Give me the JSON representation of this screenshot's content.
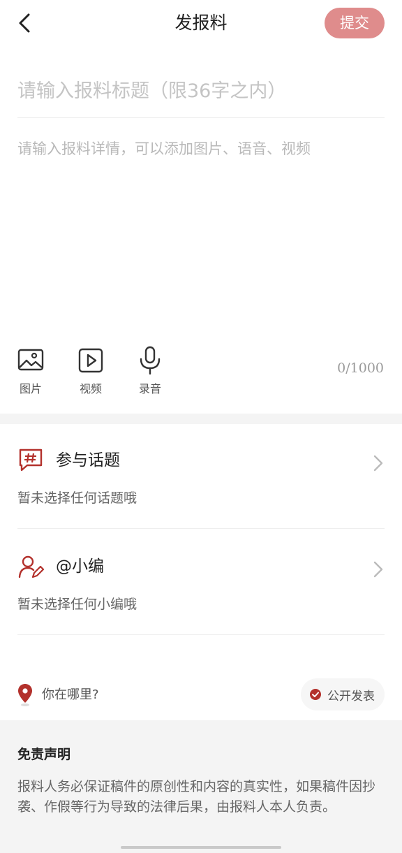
{
  "header": {
    "title": "发报料",
    "submit_label": "提交"
  },
  "form": {
    "title_placeholder": "请输入报料标题（限36字之内）",
    "detail_placeholder": "请输入报料详情，可以添加图片、语音、视频",
    "counter": "0/1000"
  },
  "media": {
    "image_label": "图片",
    "video_label": "视频",
    "audio_label": "录音"
  },
  "options": {
    "topic": {
      "title": "参与话题",
      "subtitle": "暂未选择任何话题哦"
    },
    "editor": {
      "title": "@小编",
      "subtitle": "暂未选择任何小编哦"
    }
  },
  "location": {
    "label": "你在哪里?"
  },
  "public_chip": {
    "label": "公开发表"
  },
  "disclaimer": {
    "title": "免责声明",
    "body": "报料人务必保证稿件的原创性和内容的真实性，如果稿件因抄袭、作假等行为导致的法律后果，由报料人本人负责。"
  },
  "colors": {
    "accent": "#df8c8c",
    "brand_red": "#b3312c"
  },
  "icons": {
    "back": "back-arrow-icon",
    "image": "image-icon",
    "video": "video-icon",
    "audio": "microphone-icon",
    "topic": "hashtag-icon",
    "editor": "user-edit-icon",
    "chevron": "chevron-right-icon",
    "location": "location-pin-icon",
    "check": "check-circle-icon"
  }
}
